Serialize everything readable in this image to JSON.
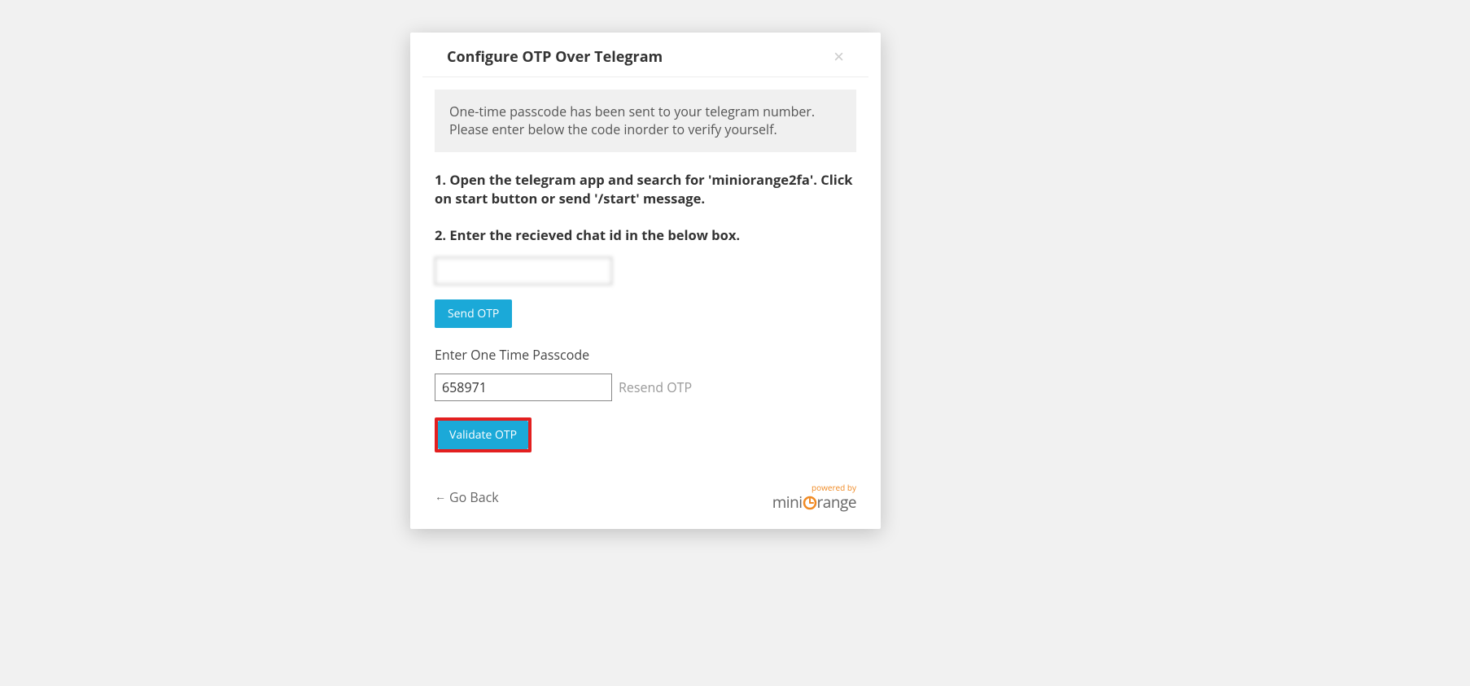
{
  "modal": {
    "title": "Configure OTP Over Telegram",
    "info_message": "One-time passcode has been sent to your telegram number. Please enter below the code inorder to verify yourself.",
    "instruction_1": "1. Open the telegram app and search for 'miniorange2fa'. Click on start button or send '/start' message.",
    "instruction_2": "2. Enter the recieved chat id in the below box.",
    "chat_id_value": "",
    "send_otp_label": "Send OTP",
    "otp_label": "Enter One Time Passcode",
    "otp_value": "658971",
    "resend_label": "Resend OTP",
    "validate_label": "Validate OTP",
    "go_back_label": "Go Back",
    "powered_by": "powered by",
    "brand_part1": "mini",
    "brand_part2": "range"
  }
}
